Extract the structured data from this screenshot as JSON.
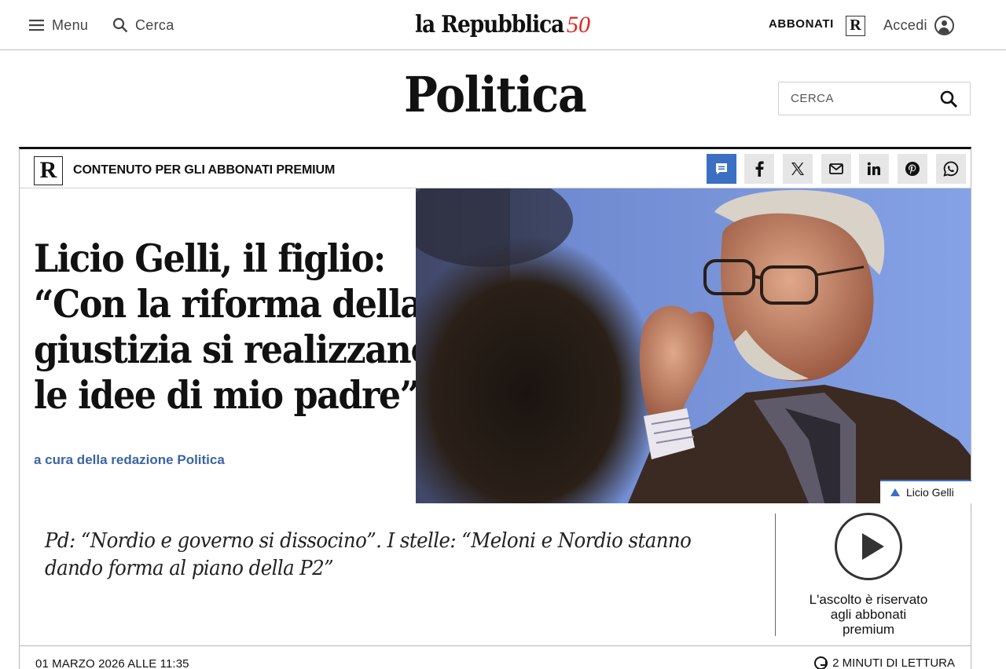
{
  "topbar": {
    "menu_label": "Menu",
    "search_label": "Cerca",
    "logo_text": "la Repubblica",
    "logo_anniversary": "50",
    "subscribe_label": "ABBONATI",
    "login_label": "Accedi"
  },
  "section": {
    "title": "Politica",
    "search_placeholder": "CERCA"
  },
  "article": {
    "premium_mark": "R",
    "premium_label": "CONTENUTO PER GLI ABBONATI PREMIUM",
    "share_icons": [
      "comment-icon",
      "facebook-icon",
      "x-icon",
      "mail-icon",
      "linkedin-icon",
      "pinterest-icon",
      "whatsapp-icon"
    ],
    "headline_lines": [
      "Licio Gelli, il figlio:",
      "“Con la riforma della",
      "giustizia si realizzano",
      "le idee di mio padre”"
    ],
    "byline": "a cura della redazione Politica",
    "photo_caption": "Licio Gelli",
    "summary_lines": [
      "Pd: “Nordio e governo si dissocino”. I stelle: “Meloni e Nordio stanno",
      "dando forma al piano della P2”"
    ],
    "audio_note_lines": [
      "L'ascolto è riservato",
      "agli abbonati",
      "premium"
    ],
    "date": "01 MARZO 2026 ALLE 11:35",
    "read_time": "2 MINUTI DI LETTURA"
  },
  "colors": {
    "accent_blue": "#3a6fc4",
    "byline_blue": "#3b64a6",
    "logo_red": "#e0251b"
  }
}
